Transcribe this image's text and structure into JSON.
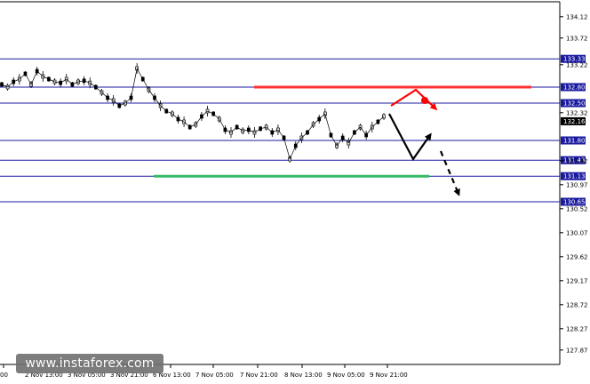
{
  "chart_data": {
    "type": "candlestick",
    "y_axis_position": "right",
    "ylim": [
      127.6,
      134.4
    ],
    "y_ticks": [
      "134.12",
      "133.72",
      "133.22",
      "132.32",
      "131.42",
      "130.97",
      "130.52",
      "130.07",
      "129.62",
      "129.17",
      "128.72",
      "128.27",
      "127.87"
    ],
    "x_ticks": [
      "00",
      "2 Nov 13:00",
      "3 Nov 05:00",
      "3 Nov 21:00",
      "6 Nov 13:00",
      "7 Nov 05:00",
      "7 Nov 21:00",
      "8 Nov 13:00",
      "9 Nov 05:00",
      "9 Nov 21:00"
    ],
    "levels": [
      {
        "value": 133.33,
        "label": "133.33"
      },
      {
        "value": 132.8,
        "label": "132.80"
      },
      {
        "value": 132.5,
        "label": "132.50"
      },
      {
        "value": 132.16,
        "label": "132.16",
        "current": true
      },
      {
        "value": 131.8,
        "label": "131.80"
      },
      {
        "value": 131.43,
        "label": "131.43"
      },
      {
        "value": 131.13,
        "label": "131.13"
      },
      {
        "value": 130.65,
        "label": "130.65"
      }
    ],
    "price_path": [
      132.85,
      132.8,
      132.9,
      132.95,
      133.05,
      132.85,
      133.1,
      133.0,
      132.95,
      132.9,
      132.88,
      132.95,
      132.85,
      132.9,
      132.92,
      132.88,
      132.8,
      132.7,
      132.6,
      132.55,
      132.45,
      132.5,
      132.6,
      133.15,
      132.95,
      132.75,
      132.6,
      132.45,
      132.35,
      132.3,
      132.2,
      132.15,
      132.05,
      132.1,
      132.25,
      132.35,
      132.3,
      132.2,
      132.0,
      131.95,
      132.05,
      131.98,
      132.0,
      131.95,
      132.02,
      132.05,
      131.95,
      132.0,
      131.85,
      131.45,
      131.7,
      131.85,
      131.95,
      132.1,
      132.2,
      132.3,
      131.9,
      131.7,
      131.85,
      131.75,
      131.95,
      132.05,
      131.9,
      132.05,
      132.15,
      132.25
    ],
    "projections": [
      {
        "style": "solid",
        "color": "#ff0000",
        "points": [
          [
            132.45,
            0
          ],
          [
            132.75,
            1
          ],
          [
            132.4,
            2
          ]
        ]
      },
      {
        "style": "solid",
        "color": "#000000",
        "points": [
          [
            132.3,
            0
          ],
          [
            131.45,
            1
          ],
          [
            131.9,
            2
          ]
        ]
      },
      {
        "style": "dashed",
        "color": "#000000",
        "points": [
          [
            131.6,
            0
          ],
          [
            130.8,
            1
          ]
        ]
      }
    ],
    "resistance_line": {
      "value": 132.8,
      "color": "#ff3333"
    },
    "support_line": {
      "value": 131.13,
      "color": "#33bb66"
    },
    "grid": false
  },
  "watermark": "www.instaforex.com"
}
